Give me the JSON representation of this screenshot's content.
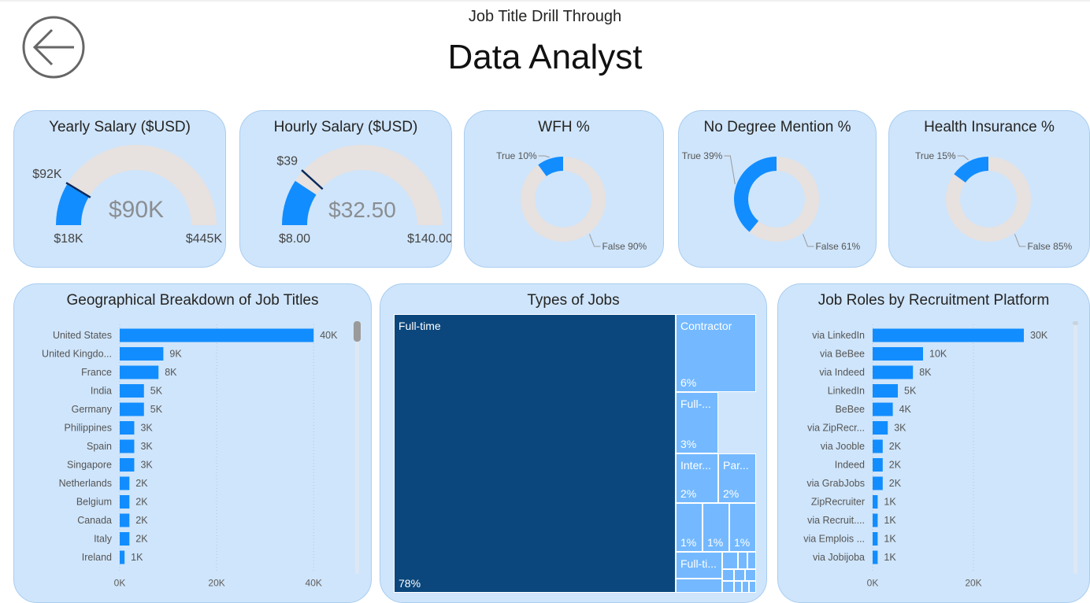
{
  "page": {
    "subtitle": "Job Title Drill Through",
    "title": "Data Analyst"
  },
  "back_button": {
    "icon": "arrow-left-circle-icon"
  },
  "colors": {
    "accent": "#118dff",
    "track": "#e7e1df",
    "dark_blue": "#0b477c",
    "mid_blue": "#74b9ff",
    "card_bg": "#cfe5fb"
  },
  "gauges": [
    {
      "title": "Yearly Salary ($USD)",
      "value_label": "$90K",
      "value": 90,
      "min_label": "$18K",
      "min": 18,
      "max_label": "$445K",
      "max": 445,
      "target_label": "$92K",
      "target": 92
    },
    {
      "title": "Hourly Salary ($USD)",
      "value_label": "$32.50",
      "value": 32.5,
      "min_label": "$8.00",
      "min": 8,
      "max_label": "$140.00",
      "max": 140,
      "target_label": "$39",
      "target": 39
    }
  ],
  "donuts": [
    {
      "title": "WFH %",
      "true_label": "True 10%",
      "false_label": "False 90%",
      "true_pct": 10
    },
    {
      "title": "No Degree Mention %",
      "true_label": "True 39%",
      "false_label": "False 61%",
      "true_pct": 39
    },
    {
      "title": "Health Insurance %",
      "true_label": "True 15%",
      "false_label": "False 85%",
      "true_pct": 15
    }
  ],
  "chart_data": [
    {
      "type": "bar",
      "orientation": "horizontal",
      "title": "Geographical Breakdown of Job Titles",
      "categories": [
        "United States",
        "United Kingdo...",
        "France",
        "India",
        "Germany",
        "Philippines",
        "Spain",
        "Singapore",
        "Netherlands",
        "Belgium",
        "Canada",
        "Italy",
        "Ireland"
      ],
      "values": [
        40000,
        9000,
        8000,
        5000,
        5000,
        3000,
        3000,
        3000,
        2000,
        2000,
        2000,
        2000,
        1000
      ],
      "data_labels": [
        "40K",
        "9K",
        "8K",
        "5K",
        "5K",
        "3K",
        "3K",
        "3K",
        "2K",
        "2K",
        "2K",
        "2K",
        "1K"
      ],
      "x_ticks": [
        0,
        20000,
        40000
      ],
      "x_tick_labels": [
        "0K",
        "20K",
        "40K"
      ],
      "xlim": [
        0,
        45000
      ],
      "grid": true
    },
    {
      "type": "bar",
      "orientation": "horizontal",
      "title": "Job Roles by Recruitment Platform",
      "categories": [
        "via LinkedIn",
        "via BeBee",
        "via Indeed",
        "LinkedIn",
        "BeBee",
        "via ZipRecr...",
        "via Jooble",
        "Indeed",
        "via GrabJobs",
        "ZipRecruiter",
        "via Recruit....",
        "via Emplois ...",
        "via Jobijoba"
      ],
      "values": [
        30000,
        10000,
        8000,
        5000,
        4000,
        3000,
        2000,
        2000,
        2000,
        1000,
        1000,
        1000,
        1000
      ],
      "data_labels": [
        "30K",
        "10K",
        "8K",
        "5K",
        "4K",
        "3K",
        "2K",
        "2K",
        "2K",
        "1K",
        "1K",
        "1K",
        "1K"
      ],
      "x_ticks": [
        0,
        20000
      ],
      "x_tick_labels": [
        "0K",
        "20K"
      ],
      "xlim": [
        0,
        35000
      ],
      "grid": true
    },
    {
      "type": "treemap",
      "title": "Types of Jobs",
      "items": [
        {
          "name": "Full-time",
          "pct_label": "78%",
          "pct": 78
        },
        {
          "name": "Contractor",
          "pct_label": "6%",
          "pct": 6
        },
        {
          "name": "Full-...",
          "pct_label": "3%",
          "pct": 3
        },
        {
          "name": "Inter...",
          "pct_label": "2%",
          "pct": 2
        },
        {
          "name": "Par...",
          "pct_label": "2%",
          "pct": 2
        },
        {
          "name": "",
          "pct_label": "1%",
          "pct": 1
        },
        {
          "name": "",
          "pct_label": "1%",
          "pct": 1
        },
        {
          "name": "",
          "pct_label": "1%",
          "pct": 1
        },
        {
          "name": "Full-ti...",
          "pct_label": "",
          "pct": 1
        }
      ]
    }
  ]
}
